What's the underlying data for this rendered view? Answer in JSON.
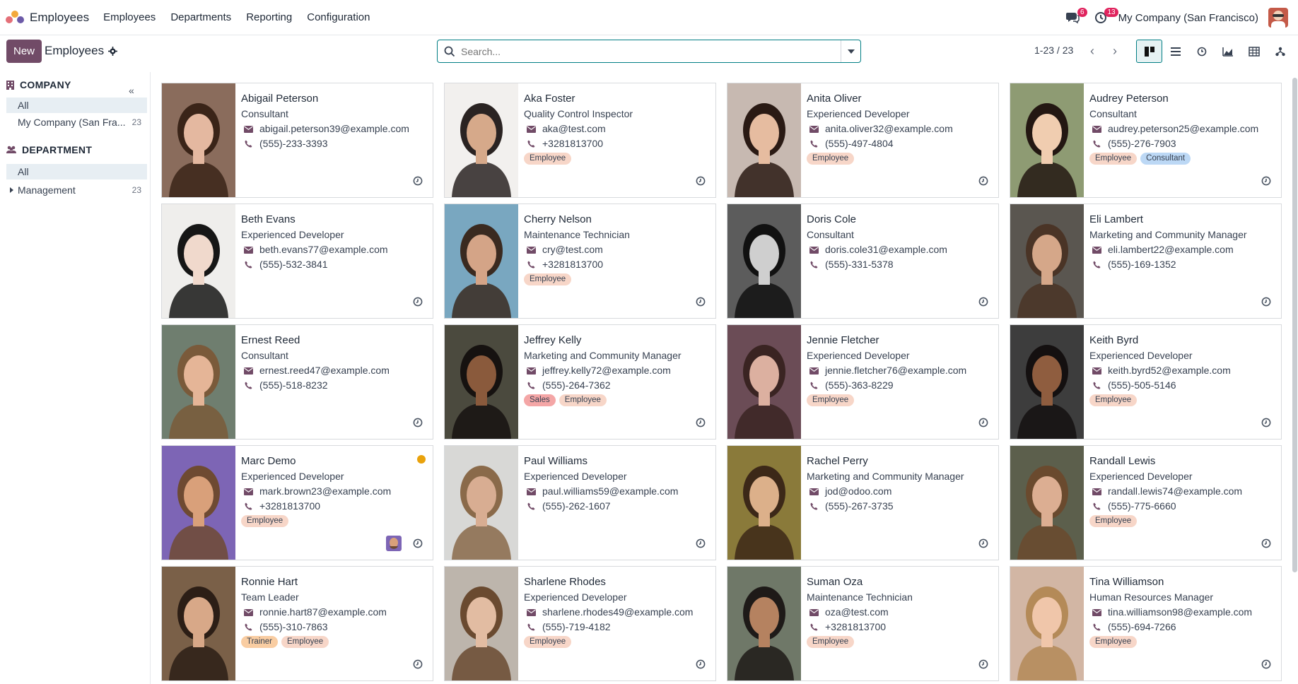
{
  "navbar": {
    "app_name": "Employees",
    "menus": [
      "Employees",
      "Departments",
      "Reporting",
      "Configuration"
    ],
    "messages_count": "6",
    "activities_count": "13",
    "company": "My Company (San Francisco)"
  },
  "control_panel": {
    "new_label": "New",
    "title": "Employees",
    "search_placeholder": "Search...",
    "pager": "1-23 / 23"
  },
  "side_panel": {
    "company_header": "COMPANY",
    "company_items": [
      {
        "label": "All",
        "count": ""
      },
      {
        "label": "My Company (San Fra...",
        "count": "23"
      }
    ],
    "department_header": "DEPARTMENT",
    "department_items": [
      {
        "label": "All",
        "count": ""
      },
      {
        "label": "Management",
        "count": "23"
      }
    ]
  },
  "colors": {
    "primary": "#714b67",
    "accent": "#017e84",
    "tag_employee": "#f7d6c8",
    "tag_consultant": "#bcd8f5",
    "tag_sales": "#f4a6a6",
    "tag_trainer": "#f9cda2"
  },
  "employees": [
    {
      "name": "Abigail Peterson",
      "job": "Consultant",
      "email": "abigail.peterson39@example.com",
      "phone": "(555)-233-3393",
      "tags": [],
      "photo_bg": "#8a6c5c",
      "face": "#e4b8a0",
      "hair": "#3a2418"
    },
    {
      "name": "Aka Foster",
      "job": "Quality Control Inspector",
      "email": "aka@test.com",
      "phone": "+3281813700",
      "tags": [
        "Employee"
      ],
      "photo_bg": "#f2f0ee",
      "face": "#d6a98a",
      "hair": "#2a2322"
    },
    {
      "name": "Anita Oliver",
      "job": "Experienced Developer",
      "email": "anita.oliver32@example.com",
      "phone": "(555)-497-4804",
      "tags": [
        "Employee"
      ],
      "photo_bg": "#c7b9b1",
      "face": "#e6bca0",
      "hair": "#2a1a14"
    },
    {
      "name": "Audrey Peterson",
      "job": "Consultant",
      "email": "audrey.peterson25@example.com",
      "phone": "(555)-276-7903",
      "tags": [
        "Employee",
        "Consultant"
      ],
      "photo_bg": "#8e9b73",
      "face": "#f0cdb0",
      "hair": "#231712"
    },
    {
      "name": "Beth Evans",
      "job": "Experienced Developer",
      "email": "beth.evans77@example.com",
      "phone": "(555)-532-3841",
      "tags": [],
      "photo_bg": "#efeeec",
      "face": "#f0d9cc",
      "hair": "#161616"
    },
    {
      "name": "Cherry Nelson",
      "job": "Maintenance Technician",
      "email": "cry@test.com",
      "phone": "+3281813700",
      "tags": [
        "Employee"
      ],
      "photo_bg": "#79a7c0",
      "face": "#d4a487",
      "hair": "#3a2a20"
    },
    {
      "name": "Doris Cole",
      "job": "Consultant",
      "email": "doris.cole31@example.com",
      "phone": "(555)-331-5378",
      "tags": [],
      "photo_bg": "#5c5c5c",
      "face": "#cfcfcf",
      "hair": "#111111"
    },
    {
      "name": "Eli Lambert",
      "job": "Marketing and Community Manager",
      "email": "eli.lambert22@example.com",
      "phone": "(555)-169-1352",
      "tags": [],
      "photo_bg": "#5a5650",
      "face": "#d5a789",
      "hair": "#4a3426"
    },
    {
      "name": "Ernest Reed",
      "job": "Consultant",
      "email": "ernest.reed47@example.com",
      "phone": "(555)-518-8232",
      "tags": [],
      "photo_bg": "#6f7e6f",
      "face": "#e5b597",
      "hair": "#7a5a3a"
    },
    {
      "name": "Jeffrey Kelly",
      "job": "Marketing and Community Manager",
      "email": "jeffrey.kelly72@example.com",
      "phone": "(555)-264-7362",
      "tags": [
        "Sales",
        "Employee"
      ],
      "photo_bg": "#4b4a3e",
      "face": "#8a5a3c",
      "hair": "#161210"
    },
    {
      "name": "Jennie Fletcher",
      "job": "Experienced Developer",
      "email": "jennie.fletcher76@example.com",
      "phone": "(555)-363-8229",
      "tags": [
        "Employee"
      ],
      "photo_bg": "#6b4c56",
      "face": "#dcb0a0",
      "hair": "#3a2422"
    },
    {
      "name": "Keith Byrd",
      "job": "Experienced Developer",
      "email": "keith.byrd52@example.com",
      "phone": "(555)-505-5146",
      "tags": [
        "Employee"
      ],
      "photo_bg": "#3d3d3d",
      "face": "#8f5d3f",
      "hair": "#141010"
    },
    {
      "name": "Marc Demo",
      "job": "Experienced Developer",
      "email": "mark.brown23@example.com",
      "phone": "+3281813700",
      "tags": [
        "Employee"
      ],
      "photo_bg": "#7d65b5",
      "face": "#d9a07a",
      "hair": "#6e4a32",
      "status": true
    },
    {
      "name": "Paul Williams",
      "job": "Experienced Developer",
      "email": "paul.williams59@example.com",
      "phone": "(555)-262-1607",
      "tags": [],
      "photo_bg": "#d8d8d6",
      "face": "#d8ad92",
      "hair": "#8a6a4a"
    },
    {
      "name": "Rachel Perry",
      "job": "Marketing and Community Manager",
      "email": "jod@odoo.com",
      "phone": "(555)-267-3735",
      "tags": [],
      "photo_bg": "#8a7a3a",
      "face": "#dcb08a",
      "hair": "#3c2818"
    },
    {
      "name": "Randall Lewis",
      "job": "Experienced Developer",
      "email": "randall.lewis74@example.com",
      "phone": "(555)-775-6660",
      "tags": [
        "Employee"
      ],
      "photo_bg": "#5c5f4c",
      "face": "#dcae92",
      "hair": "#6a4a2e"
    },
    {
      "name": "Ronnie Hart",
      "job": "Team Leader",
      "email": "ronnie.hart87@example.com",
      "phone": "(555)-310-7863",
      "tags": [
        "Trainer",
        "Employee"
      ],
      "photo_bg": "#7a6048",
      "face": "#d8a888",
      "hair": "#2c1e16"
    },
    {
      "name": "Sharlene Rhodes",
      "job": "Experienced Developer",
      "email": "sharlene.rhodes49@example.com",
      "phone": "(555)-719-4182",
      "tags": [
        "Employee"
      ],
      "photo_bg": "#bdb5ac",
      "face": "#e2bca2",
      "hair": "#6a4a30"
    },
    {
      "name": "Suman Oza",
      "job": "Maintenance Technician",
      "email": "oza@test.com",
      "phone": "+3281813700",
      "tags": [
        "Employee"
      ],
      "photo_bg": "#6f7868",
      "face": "#b58260",
      "hair": "#1e1a18"
    },
    {
      "name": "Tina Williamson",
      "job": "Human Resources Manager",
      "email": "tina.williamson98@example.com",
      "phone": "(555)-694-7266",
      "tags": [
        "Employee"
      ],
      "photo_bg": "#d2b6a4",
      "face": "#f0c6aa",
      "hair": "#b48a58"
    }
  ]
}
